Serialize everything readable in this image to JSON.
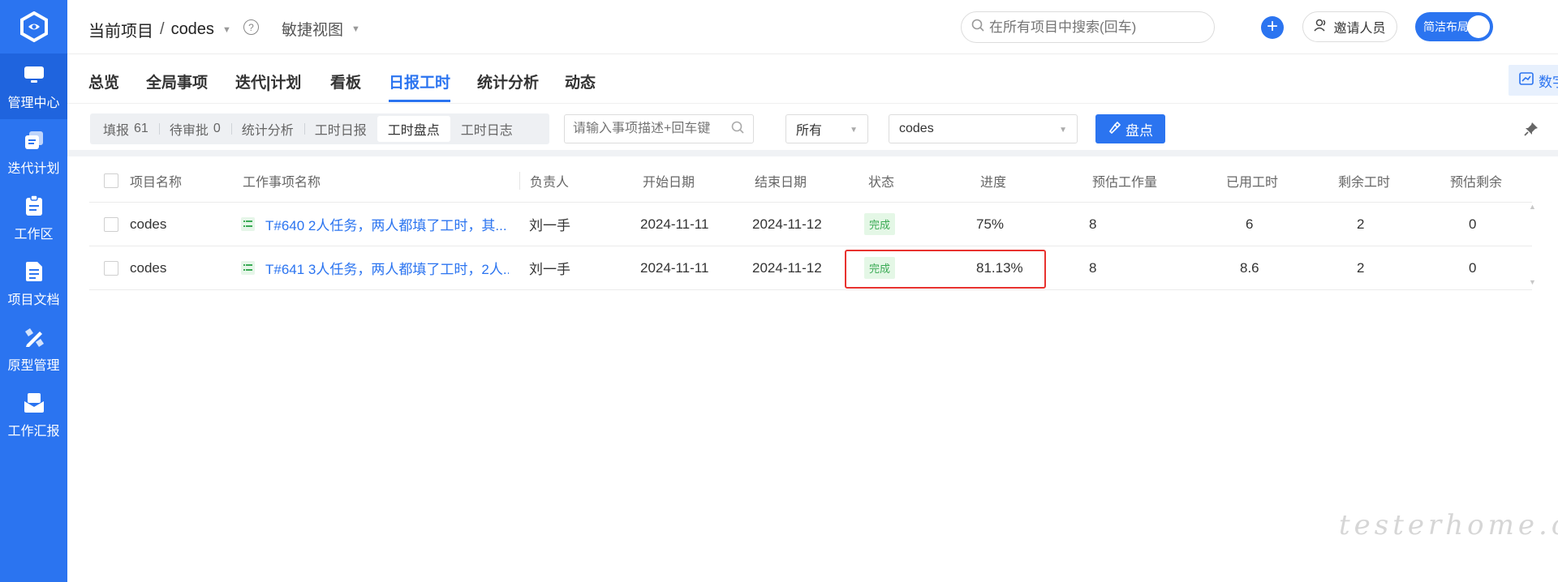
{
  "sidebar": {
    "items": [
      {
        "label": "管理中心",
        "icon": "monitor-icon"
      },
      {
        "label": "迭代计划",
        "icon": "iteration-icon"
      },
      {
        "label": "工作区",
        "icon": "clipboard-icon"
      },
      {
        "label": "项目文档",
        "icon": "document-icon"
      },
      {
        "label": "原型管理",
        "icon": "prototype-icon"
      },
      {
        "label": "工作汇报",
        "icon": "mail-icon"
      }
    ]
  },
  "header": {
    "project_label": "当前项目",
    "project_name": "codes",
    "view_label": "敏捷视图",
    "search_placeholder": "在所有项目中搜索(回车)",
    "invite_label": "邀请人员",
    "layout_toggle_label": "简洁布局"
  },
  "tabs": [
    {
      "label": "总览"
    },
    {
      "label": "全局事项"
    },
    {
      "label": "迭代|计划"
    },
    {
      "label": "看板"
    },
    {
      "label": "日报工时"
    },
    {
      "label": "统计分析"
    },
    {
      "label": "动态"
    }
  ],
  "big_screen_label": "数字大屏",
  "segments": [
    {
      "label": "填报",
      "count": "61"
    },
    {
      "label": "待审批",
      "count": "0"
    },
    {
      "label": "统计分析",
      "count": ""
    },
    {
      "label": "工时日报",
      "count": ""
    },
    {
      "label": "工时盘点",
      "count": ""
    },
    {
      "label": "工时日志",
      "count": ""
    }
  ],
  "filter": {
    "search_placeholder": "请输入事项描述+回车键",
    "scope_value": "所有",
    "project_value": "codes",
    "check_button": "盘点"
  },
  "table": {
    "headers": [
      "项目名称",
      "工作事项名称",
      "负责人",
      "开始日期",
      "结束日期",
      "状态",
      "进度",
      "预估工作量",
      "已用工时",
      "剩余工时",
      "预估剩余"
    ],
    "rows": [
      {
        "project": "codes",
        "task": "T#640 2人任务，两人都填了工时，其...",
        "owner": "刘一手",
        "start": "2024-11-11",
        "end": "2024-11-12",
        "status": "完成",
        "progress": "75%",
        "estimate": "8",
        "used": "6",
        "remaining": "2",
        "est_remaining": "0"
      },
      {
        "project": "codes",
        "task": "T#641 3人任务，两人都填了工时，2人...",
        "owner": "刘一手",
        "start": "2024-11-11",
        "end": "2024-11-12",
        "status": "完成",
        "progress": "81.13%",
        "estimate": "8",
        "used": "8.6",
        "remaining": "2",
        "est_remaining": "0"
      }
    ]
  },
  "watermark": "testerhome.com",
  "colors": {
    "primary": "#2b74f0",
    "highlight": "#e8322f",
    "status_green": "#3aaa54"
  }
}
